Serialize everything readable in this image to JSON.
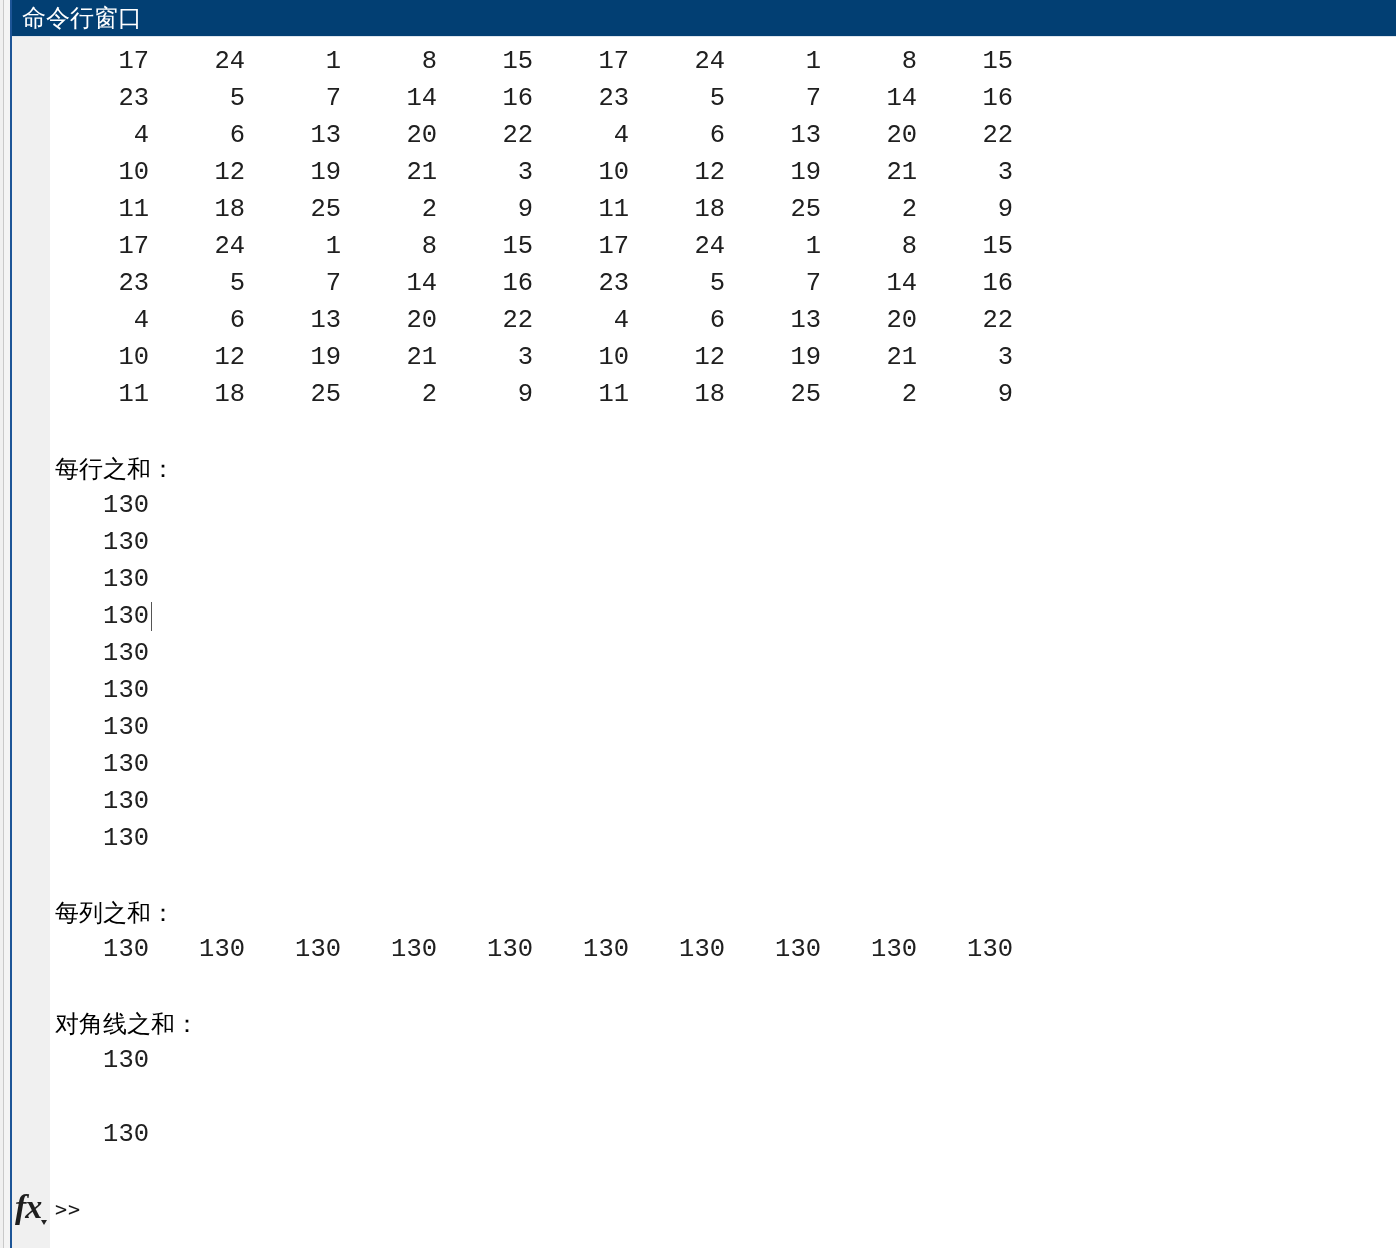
{
  "window": {
    "title": "命令行窗口"
  },
  "output": [
    {
      "kind": "row",
      "cells": [
        "17",
        "24",
        "1",
        "8",
        "15",
        "17",
        "24",
        "1",
        "8",
        "15"
      ],
      "caret": false
    },
    {
      "kind": "row",
      "cells": [
        "23",
        "5",
        "7",
        "14",
        "16",
        "23",
        "5",
        "7",
        "14",
        "16"
      ],
      "caret": false
    },
    {
      "kind": "row",
      "cells": [
        "4",
        "6",
        "13",
        "20",
        "22",
        "4",
        "6",
        "13",
        "20",
        "22"
      ],
      "caret": false
    },
    {
      "kind": "row",
      "cells": [
        "10",
        "12",
        "19",
        "21",
        "3",
        "10",
        "12",
        "19",
        "21",
        "3"
      ],
      "caret": false
    },
    {
      "kind": "row",
      "cells": [
        "11",
        "18",
        "25",
        "2",
        "9",
        "11",
        "18",
        "25",
        "2",
        "9"
      ],
      "caret": false
    },
    {
      "kind": "row",
      "cells": [
        "17",
        "24",
        "1",
        "8",
        "15",
        "17",
        "24",
        "1",
        "8",
        "15"
      ],
      "caret": false
    },
    {
      "kind": "row",
      "cells": [
        "23",
        "5",
        "7",
        "14",
        "16",
        "23",
        "5",
        "7",
        "14",
        "16"
      ],
      "caret": false
    },
    {
      "kind": "row",
      "cells": [
        "4",
        "6",
        "13",
        "20",
        "22",
        "4",
        "6",
        "13",
        "20",
        "22"
      ],
      "caret": false
    },
    {
      "kind": "row",
      "cells": [
        "10",
        "12",
        "19",
        "21",
        "3",
        "10",
        "12",
        "19",
        "21",
        "3"
      ],
      "caret": false
    },
    {
      "kind": "row",
      "cells": [
        "11",
        "18",
        "25",
        "2",
        "9",
        "11",
        "18",
        "25",
        "2",
        "9"
      ],
      "caret": false
    },
    {
      "kind": "blank"
    },
    {
      "kind": "label",
      "text": "每行之和："
    },
    {
      "kind": "row",
      "cells": [
        "130"
      ],
      "caret": false
    },
    {
      "kind": "row",
      "cells": [
        "130"
      ],
      "caret": false
    },
    {
      "kind": "row",
      "cells": [
        "130"
      ],
      "caret": false
    },
    {
      "kind": "row",
      "cells": [
        "130"
      ],
      "caret": true
    },
    {
      "kind": "row",
      "cells": [
        "130"
      ],
      "caret": false
    },
    {
      "kind": "row",
      "cells": [
        "130"
      ],
      "caret": false
    },
    {
      "kind": "row",
      "cells": [
        "130"
      ],
      "caret": false
    },
    {
      "kind": "row",
      "cells": [
        "130"
      ],
      "caret": false
    },
    {
      "kind": "row",
      "cells": [
        "130"
      ],
      "caret": false
    },
    {
      "kind": "row",
      "cells": [
        "130"
      ],
      "caret": false
    },
    {
      "kind": "blank"
    },
    {
      "kind": "label",
      "text": "每列之和："
    },
    {
      "kind": "row",
      "cells": [
        "130",
        "130",
        "130",
        "130",
        "130",
        "130",
        "130",
        "130",
        "130",
        "130"
      ],
      "caret": false
    },
    {
      "kind": "blank"
    },
    {
      "kind": "label",
      "text": "对角线之和："
    },
    {
      "kind": "row",
      "cells": [
        "130"
      ],
      "caret": false
    },
    {
      "kind": "blank"
    },
    {
      "kind": "row",
      "cells": [
        "130"
      ],
      "caret": false
    },
    {
      "kind": "blank"
    }
  ],
  "prompt": {
    "function_button": "fx",
    "text": ">>"
  }
}
